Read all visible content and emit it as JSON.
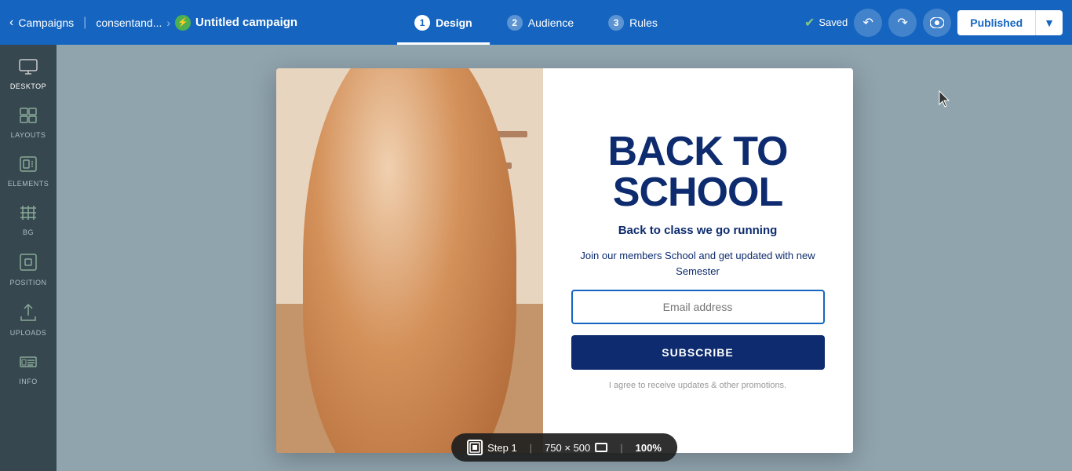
{
  "nav": {
    "campaigns_label": "Campaigns",
    "breadcrumb_site": "consentand...",
    "breadcrumb_icon": "⚡",
    "campaign_title": "Untitled campaign",
    "tabs": [
      {
        "num": "1",
        "label": "Design",
        "active": true
      },
      {
        "num": "2",
        "label": "Audience",
        "active": false
      },
      {
        "num": "3",
        "label": "Rules",
        "active": false
      }
    ],
    "saved_label": "Saved",
    "published_label": "Published"
  },
  "sidebar": {
    "items": [
      {
        "id": "desktop",
        "icon": "🖥",
        "label": "DESKTOP"
      },
      {
        "id": "layouts",
        "icon": "⊞",
        "label": "LAYOUTS"
      },
      {
        "id": "elements",
        "icon": "◧",
        "label": "ELEMENTS"
      },
      {
        "id": "bg",
        "icon": "▤",
        "label": "BG"
      },
      {
        "id": "position",
        "icon": "⊡",
        "label": "POSITION"
      },
      {
        "id": "uploads",
        "icon": "↑",
        "label": "UPLOADS"
      },
      {
        "id": "info",
        "icon": "⌨",
        "label": "INFO"
      }
    ]
  },
  "popup": {
    "heading": "BACK TO SCHOOL",
    "subheading": "Back to class we go running",
    "body": "Join our members School and get updated with new Semester",
    "email_placeholder": "Email address",
    "subscribe_label": "SUBSCRIBE",
    "disclaimer": "I agree to receive updates & other promotions."
  },
  "bottom_bar": {
    "step_icon": "⊡",
    "step_label": "Step 1",
    "dimensions": "750 × 500",
    "zoom": "100%"
  }
}
